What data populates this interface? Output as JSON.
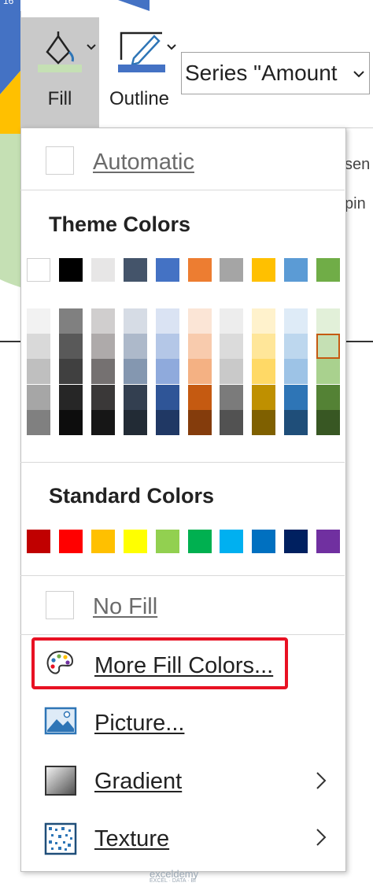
{
  "ribbon": {
    "fill_label": "Fill",
    "outline_label": "Outline",
    "series_select_value": "Series \"Amount",
    "ghost_right_top": "sen",
    "ghost_right_bottom": "pin",
    "top_left_number": "16"
  },
  "menu": {
    "automatic_label": "Automatic",
    "theme_heading": "Theme Colors",
    "standard_heading": "Standard Colors",
    "no_fill_label": "No Fill",
    "more_fill_colors_label": "More Fill Colors...",
    "picture_label": "Picture...",
    "gradient_label": "Gradient",
    "texture_label": "Texture"
  },
  "theme_colors": [
    {
      "base": "#FFFFFF",
      "shades": [
        "#F2F2F2",
        "#D9D9D9",
        "#BFBFBF",
        "#A6A6A6",
        "#808080"
      ]
    },
    {
      "base": "#000000",
      "shades": [
        "#808080",
        "#595959",
        "#404040",
        "#262626",
        "#0D0D0D"
      ]
    },
    {
      "base": "#E7E6E6",
      "shades": [
        "#D0CECE",
        "#AEAAAA",
        "#757171",
        "#3A3838",
        "#161616"
      ]
    },
    {
      "base": "#44546A",
      "shades": [
        "#D6DCE5",
        "#ADB9CA",
        "#8497B0",
        "#333F50",
        "#222B35"
      ]
    },
    {
      "base": "#4472C4",
      "shades": [
        "#DAE3F3",
        "#B4C7E7",
        "#8FAADC",
        "#2F5597",
        "#203864"
      ]
    },
    {
      "base": "#ED7D31",
      "shades": [
        "#FBE5D6",
        "#F8CBAD",
        "#F4B183",
        "#C55A11",
        "#843C0C"
      ]
    },
    {
      "base": "#A5A5A5",
      "shades": [
        "#EDEDED",
        "#DBDBDB",
        "#C9C9C9",
        "#7B7B7B",
        "#525252"
      ]
    },
    {
      "base": "#FFC000",
      "shades": [
        "#FFF2CC",
        "#FFE699",
        "#FFD966",
        "#BF9000",
        "#7F6000"
      ]
    },
    {
      "base": "#5B9BD5",
      "shades": [
        "#DEEBF7",
        "#BDD7EE",
        "#9DC3E6",
        "#2E75B6",
        "#1F4E79"
      ]
    },
    {
      "base": "#70AD47",
      "shades": [
        "#E2F0D9",
        "#C5E0B4",
        "#A9D18E",
        "#548235",
        "#385723"
      ]
    }
  ],
  "selected_theme_color": {
    "column": 9,
    "shade": 1
  },
  "standard_colors": [
    "#C00000",
    "#FF0000",
    "#FFC000",
    "#FFFF00",
    "#92D050",
    "#00B050",
    "#00B0F0",
    "#0070C0",
    "#002060",
    "#7030A0"
  ],
  "watermark": "exceldemy",
  "watermark_sub": "EXCEL · DATA · BI"
}
